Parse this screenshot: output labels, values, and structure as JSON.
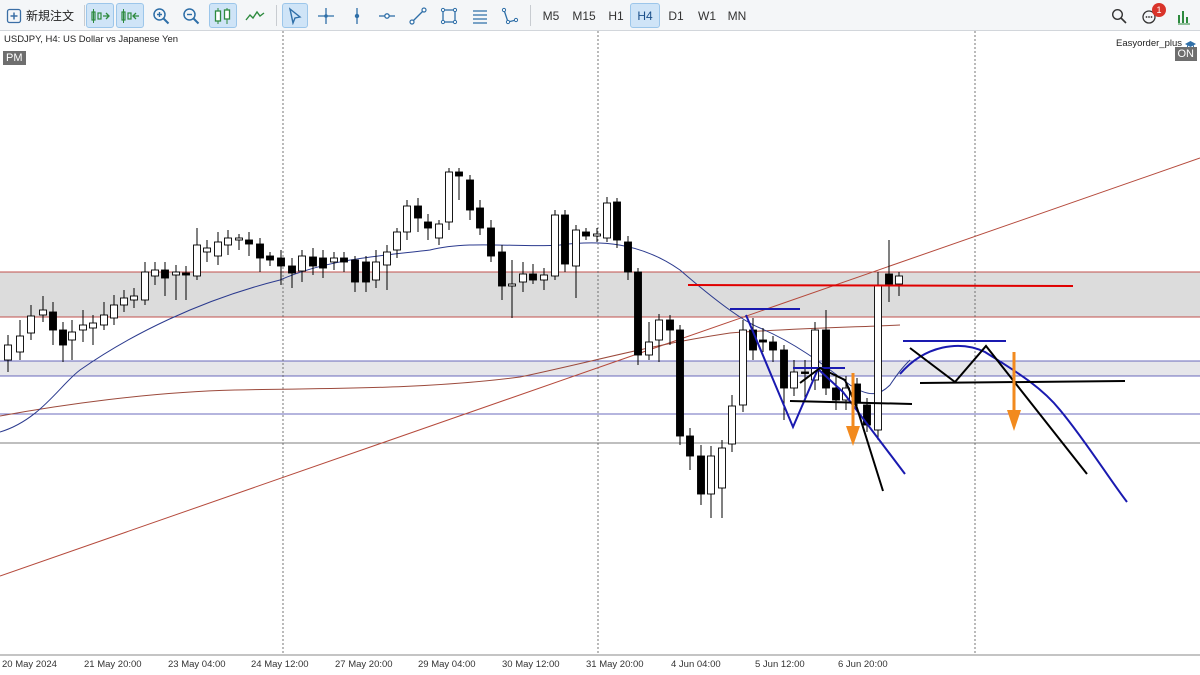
{
  "toolbar": {
    "new_order_label": "新規注文",
    "timeframes": [
      "M5",
      "M15",
      "H1",
      "H4",
      "D1",
      "W1",
      "MN"
    ],
    "active_timeframe": "H4",
    "notification_count": "1"
  },
  "chart": {
    "symbol_title": "USDJPY, H4:  US Dollar vs Japanese Yen",
    "session_label": "PM",
    "ea_name": "Easyorder_plus",
    "ea_status": "ON",
    "x_labels": [
      "20 May 2024",
      "21 May 20:00",
      "23 May 04:00",
      "24 May 12:00",
      "27 May 20:00",
      "29 May 04:00",
      "30 May 12:00",
      "31 May 20:00",
      "4 Jun 04:00",
      "5 Jun 12:00",
      "6 Jun 20:00"
    ]
  },
  "colors": {
    "bull": "#ffffff",
    "bear": "#000000",
    "zone_fill": "#dcdcdc",
    "zone_border": "#c0504d",
    "lower_zone_fill": "#e6e6ea",
    "lower_zone_border": "#3a3aa8",
    "red_level": "#e00000",
    "blue_draw": "#1a1ab0",
    "orange_arrow": "#f28a1e",
    "trend_line": "#b54a3c"
  }
}
